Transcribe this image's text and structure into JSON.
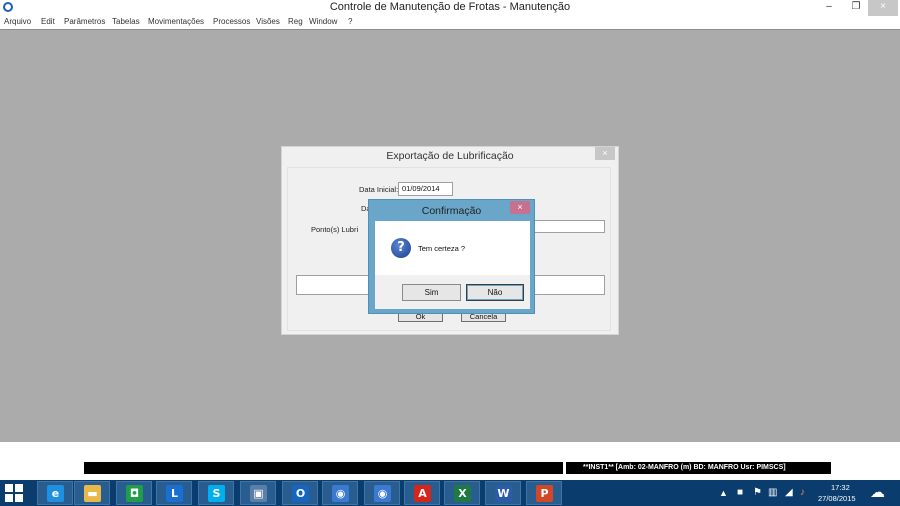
{
  "window": {
    "title": "Controle de Manutenção de Frotas - Manutenção",
    "min_glyph": "–",
    "restore_glyph": "❐",
    "close_glyph": "×"
  },
  "menu": [
    "Arquivo",
    "Edit",
    "Parâmetros",
    "Tabelas",
    "Movimentações",
    "Processos",
    "Visões",
    "Reg",
    "Window",
    "?"
  ],
  "export_window": {
    "title": "Exportação de Lubrificação",
    "close_glyph": "×",
    "data_inicial_label": "Data Inicial:",
    "data_inicial_value": "01/09/2014",
    "data_final_label_partial": "Da",
    "pontos_label_partial": "Ponto(s) Lubri",
    "ok_label": "Ok",
    "cancel_label": "Cancela"
  },
  "confirm_dialog": {
    "title": "Confirmação",
    "close_glyph": "×",
    "icon": "question-icon",
    "message": "Tem certeza ?",
    "yes_label": "Sim",
    "no_label": "Não"
  },
  "status_bar": {
    "info": "**INST1**  [Amb: 02-MANFRO  (m) BD: MANFRO Usr: PIMSCS]"
  },
  "taskbar": {
    "apps": [
      {
        "name": "internet-explorer-icon",
        "glyph": "e",
        "color": "#1e90e0"
      },
      {
        "name": "file-explorer-icon",
        "glyph": "▬",
        "color": "#e8b84a"
      },
      {
        "name": "store-icon",
        "glyph": "◘",
        "color": "#1f9e4a"
      },
      {
        "name": "lync-icon",
        "glyph": "L",
        "color": "#1a6fd0"
      },
      {
        "name": "skype-icon",
        "glyph": "S",
        "color": "#00aff0"
      },
      {
        "name": "remote-desktop-icon",
        "glyph": "▣",
        "color": "#5a7fa8"
      },
      {
        "name": "outlook-icon",
        "glyph": "O",
        "color": "#1666c0"
      },
      {
        "name": "app-icon-1",
        "glyph": "◉",
        "color": "#3a7ad0"
      },
      {
        "name": "app-icon-2",
        "glyph": "◉",
        "color": "#3a7ad0"
      },
      {
        "name": "acrobat-icon",
        "glyph": "A",
        "color": "#d8251c"
      },
      {
        "name": "excel-icon",
        "glyph": "X",
        "color": "#1f7a42"
      },
      {
        "name": "word-icon",
        "glyph": "W",
        "color": "#2a5ca8"
      },
      {
        "name": "powerpoint-icon",
        "glyph": "P",
        "color": "#d24726"
      }
    ],
    "clock_time": "17:32",
    "clock_date": "27/08/2015"
  }
}
